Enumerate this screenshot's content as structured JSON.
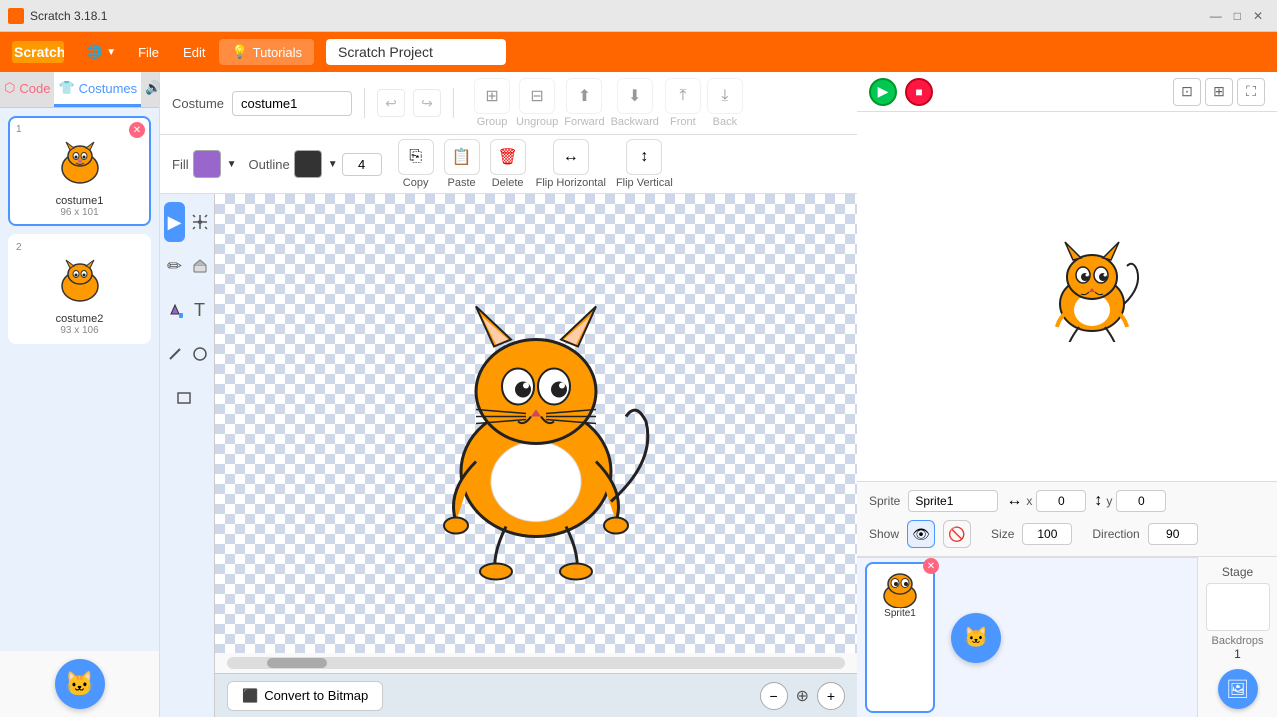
{
  "titlebar": {
    "title": "Scratch 3.18.1",
    "minimize": "—",
    "maximize": "□",
    "close": "✕"
  },
  "menubar": {
    "globe_icon": "🌐",
    "file": "File",
    "edit": "Edit",
    "tutorials_icon": "💡",
    "tutorials": "Tutorials",
    "project_name": "Scratch Project"
  },
  "tabs": {
    "code": "Code",
    "costumes": "Costumes",
    "sounds": "Sounds"
  },
  "toolbar": {
    "costume_label": "Costume",
    "costume_name": "costume1",
    "undo_label": "↩",
    "redo_label": "↪"
  },
  "toolbar2": {
    "fill_label": "Fill",
    "fill_color": "#9966cc",
    "outline_label": "Outline",
    "outline_color": "#333333",
    "outline_width": "4"
  },
  "actions": {
    "group": "Group",
    "ungroup": "Ungroup",
    "forward": "Forward",
    "backward": "Backward",
    "front": "Front",
    "back": "Back",
    "copy": "Copy",
    "paste": "Paste",
    "delete": "Delete",
    "flip_h": "Flip Horizontal",
    "flip_v": "Flip Vertical"
  },
  "tools": {
    "select": "▶",
    "reshape": "⟐",
    "brush": "✏",
    "eraser": "◫",
    "fill": "⬟",
    "text": "T",
    "line": "/",
    "circle": "○",
    "rectangle": "□"
  },
  "bottom_bar": {
    "convert_btn": "Convert to Bitmap",
    "zoom_out": "−",
    "zoom_in": "+"
  },
  "stage": {
    "green_flag": "▶",
    "stop": "■"
  },
  "sprite_info": {
    "sprite_label": "Sprite",
    "sprite_name": "Sprite1",
    "x_label": "x",
    "x_value": "0",
    "y_label": "y",
    "y_value": "0",
    "show_label": "Show",
    "size_label": "Size",
    "size_value": "100",
    "direction_label": "Direction",
    "direction_value": "90"
  },
  "costumes": [
    {
      "number": "1",
      "name": "costume1",
      "size": "96 x 101",
      "selected": true
    },
    {
      "number": "2",
      "name": "costume2",
      "size": "93 x 106",
      "selected": false
    }
  ],
  "sprite_list": [
    {
      "name": "Sprite1",
      "selected": true
    }
  ],
  "stage_panel": {
    "label": "Stage",
    "backdrops_label": "Backdrops",
    "backdrops_count": "1"
  }
}
